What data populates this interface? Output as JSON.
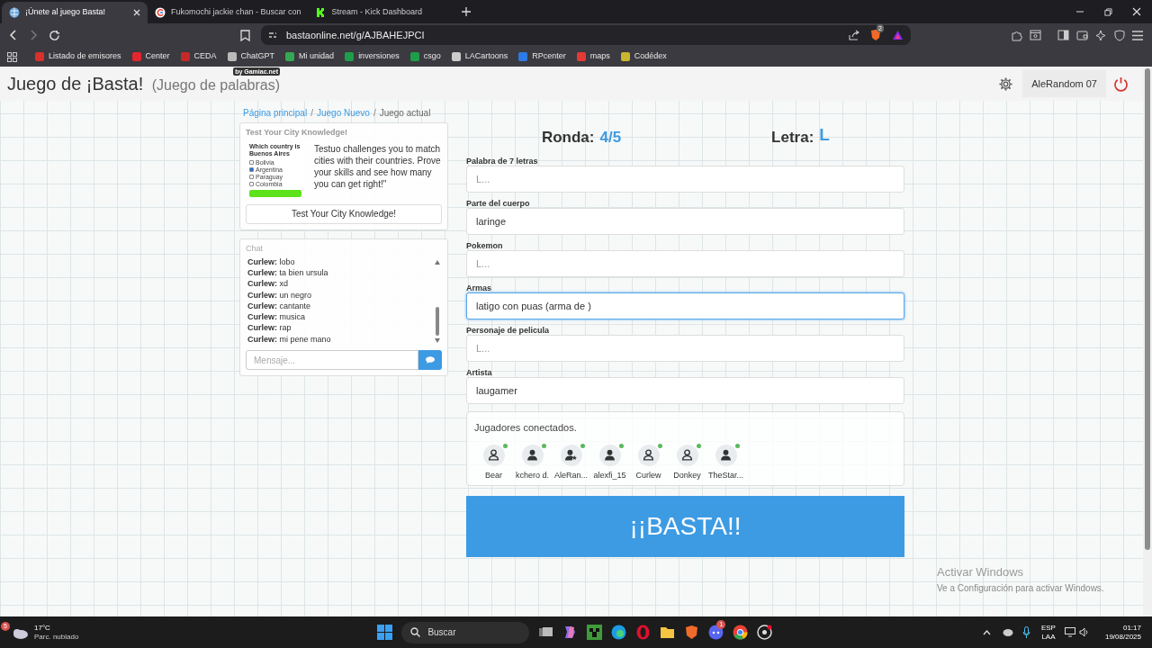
{
  "browser": {
    "tabs": [
      {
        "title": "¡Únete al juego Basta!",
        "selected": true
      },
      {
        "title": "Fukomochi jackie chan - Buscar con",
        "selected": false
      },
      {
        "title": "Stream - Kick Dashboard",
        "selected": false
      }
    ],
    "url": "bastaonline.net/g/AJBAHEJPCI",
    "shield_badge": "2",
    "bookmarks": [
      {
        "label": "Listado de emisores",
        "color": "#d9302c"
      },
      {
        "label": "Center",
        "color": "#e4262f"
      },
      {
        "label": "CEDA",
        "color": "#c62828"
      },
      {
        "label": "ChatGPT",
        "color": "#bbbbbb"
      },
      {
        "label": "Mi unidad",
        "color": "#34a853"
      },
      {
        "label": "inversiones",
        "color": "#1e9e4a"
      },
      {
        "label": "csgo",
        "color": "#1e9e4a"
      },
      {
        "label": "LACartoons",
        "color": "#cccccc"
      },
      {
        "label": "RPcenter",
        "color": "#2d7be5"
      },
      {
        "label": "maps",
        "color": "#e53935"
      },
      {
        "label": "Codédex",
        "color": "#c9b52e"
      }
    ]
  },
  "header": {
    "title": "Juego de ¡Basta!",
    "subtitle": "(Juego de palabras)",
    "badge": "by Gamiac.net",
    "user": "AleRandom 07"
  },
  "breadcrumb": {
    "separator": "/",
    "items": [
      {
        "label": "Página principal",
        "link": true
      },
      {
        "label": "Juego Nuevo",
        "link": true
      },
      {
        "label": "Juego actual",
        "link": false
      }
    ]
  },
  "ad": {
    "title": "Test Your City Knowledge!",
    "question": "Which country is Buenos Aires",
    "options": [
      {
        "label": "Bolivia",
        "checked": false
      },
      {
        "label": "Argentina",
        "checked": true
      },
      {
        "label": "Paraguay",
        "checked": false
      },
      {
        "label": "Colombia",
        "checked": false
      }
    ],
    "text": "Testuo challenges you to match cities with their countries. Prove your skills and see how many you can get right!\"",
    "button": "Test Your City Knowledge!"
  },
  "chat": {
    "title": "Chat",
    "messages": [
      "**Curlew:** lobo",
      "**Curlew:** ta bien ursula",
      "**Curlew:** xd",
      "**Curlew:** un negro",
      "**Curlew:** cantante",
      "**Curlew:** musica",
      "**Curlew:** rap",
      "**Curlew:** mi pene mano"
    ],
    "placeholder": "Mensaje..."
  },
  "round": {
    "label": "Ronda:",
    "value": "4/5"
  },
  "letter": {
    "label": "Letra:",
    "value": "L"
  },
  "fields": [
    {
      "label": "Palabra de 7 letras",
      "placeholder": "L...",
      "focused": false
    },
    {
      "label": "Parte del cuerpo",
      "value": "laringe",
      "focused": false
    },
    {
      "label": "Pokemon",
      "placeholder": "L...",
      "focused": false
    },
    {
      "label": "Armas",
      "value": "latigo con puas (arma de )",
      "focused": true
    },
    {
      "label": "Personaje de pelicula",
      "placeholder": "L...",
      "focused": false
    },
    {
      "label": "Artista",
      "value": "laugamer",
      "focused": false
    }
  ],
  "players": {
    "title": "Jugadores conectados.",
    "items": [
      {
        "name": "Bear",
        "kind": "outline",
        "online": true
      },
      {
        "name": "kchero d.",
        "kind": "filled",
        "online": true
      },
      {
        "name": "AleRan...",
        "kind": "admin",
        "online": true
      },
      {
        "name": "alexfi_15",
        "kind": "filled",
        "online": true
      },
      {
        "name": "Curlew",
        "kind": "outline",
        "online": true
      },
      {
        "name": "Donkey",
        "kind": "outline",
        "online": true
      },
      {
        "name": "TheStar...",
        "kind": "filled",
        "online": true
      }
    ]
  },
  "basta_button": "¡¡BASTA!!",
  "windows_notice": {
    "title": "Activar Windows",
    "text": "Ve a Configuración para activar Windows."
  },
  "taskbar": {
    "temperature": "17°C",
    "weather": "Parc. nublado",
    "weather_badge": "5",
    "search": "Buscar",
    "discord_badge": "1",
    "language": "ESP",
    "layout": "LAA",
    "time": "01:17",
    "date": "19/08/2025"
  }
}
